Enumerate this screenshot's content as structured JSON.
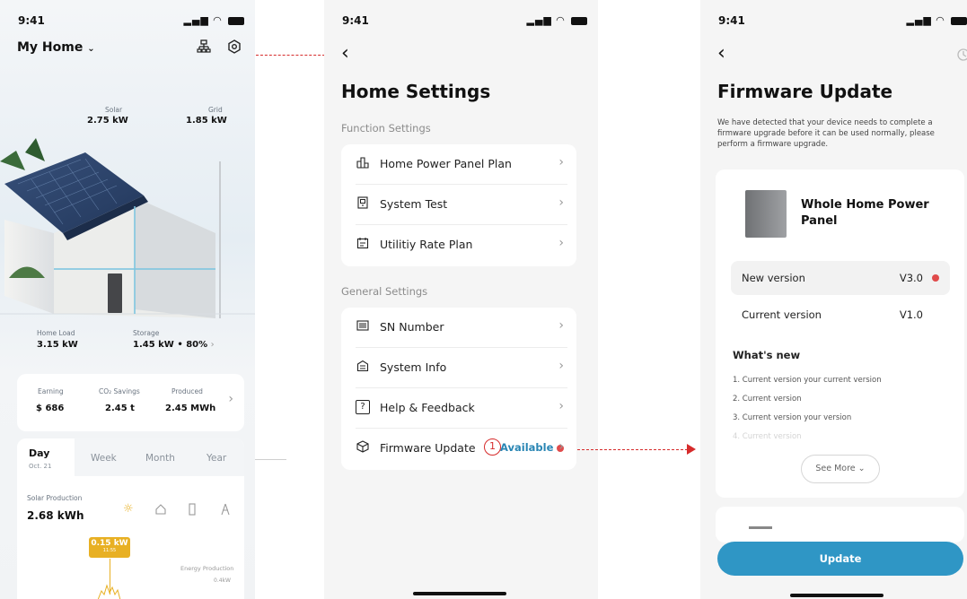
{
  "status": {
    "time": "9:41"
  },
  "screen1": {
    "home_selector": "My Home",
    "solar": {
      "label": "Solar",
      "value": "2.75 kW"
    },
    "grid": {
      "label": "Grid",
      "value": "1.85 kW"
    },
    "home_load": {
      "label": "Home Load",
      "value": "3.15 kW"
    },
    "storage": {
      "label": "Storage",
      "value": "1.45 kW • 80%"
    },
    "summary": [
      {
        "label": "Earning",
        "value": "$ 686"
      },
      {
        "label": "CO₂ Savings",
        "value": "2.45 t"
      },
      {
        "label": "Produced",
        "value": "2.45 MWh"
      }
    ],
    "tabs": {
      "day": "Day",
      "day_date": "Oct. 21",
      "week": "Week",
      "month": "Month",
      "year": "Year"
    },
    "production": {
      "label": "Solar Production",
      "value": "2.68 kWh"
    },
    "tooltip": {
      "value": "0.15 kW",
      "time": "11:55"
    },
    "legend_label": "Energy Production",
    "axis_value": "0.4kW"
  },
  "screen2": {
    "title": "Home Settings",
    "function_label": "Function Settings",
    "function_items": [
      {
        "label": "Home Power Panel Plan",
        "icon": "panel-plan-icon"
      },
      {
        "label": "System Test",
        "icon": "system-test-icon"
      },
      {
        "label": "Utilitiy Rate Plan",
        "icon": "rate-plan-icon"
      }
    ],
    "general_label": "General Settings",
    "general_items": [
      {
        "label": "SN Number",
        "icon": "barcode-icon"
      },
      {
        "label": "System Info",
        "icon": "system-info-icon"
      },
      {
        "label": "Help & Feedback",
        "icon": "help-icon"
      },
      {
        "label": "Firmware Update",
        "icon": "firmware-icon"
      }
    ],
    "firmware_status": "Available",
    "annotation_number": "1"
  },
  "screen3": {
    "title": "Firmware Update",
    "description": "We have detected that your device needs to complete a firmware upgrade before it can be used normally, please perform a firmware upgrade.",
    "device_name": "Whole Home Power Panel",
    "new_version": {
      "label": "New version",
      "value": "V3.0"
    },
    "current_version": {
      "label": "Current version",
      "value": "V1.0"
    },
    "whats_new_title": "What's new",
    "whats_new": [
      "1. Current version your current version",
      "2. Current version",
      "3. Current version your version",
      "4. Current version"
    ],
    "see_more": "See More",
    "update_button": "Update"
  },
  "colors": {
    "accent": "#2f96c5",
    "alert": "#e04b4b",
    "annotation": "#d62b2b",
    "tooltip": "#e8b023"
  }
}
